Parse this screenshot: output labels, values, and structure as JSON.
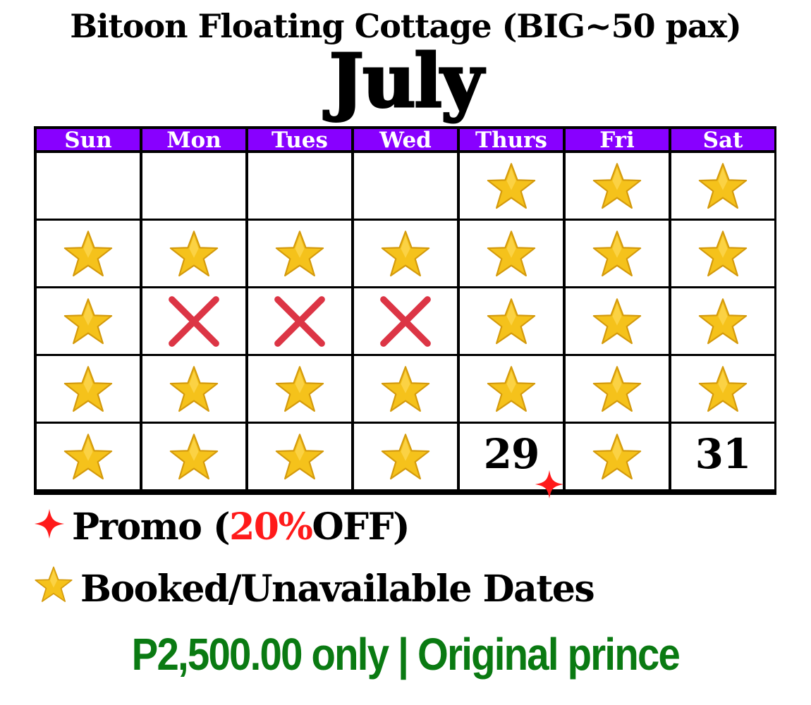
{
  "title": "Bitoon Floating Cottage (BIG~50 pax)",
  "month": "July",
  "colors": {
    "header_bg": "#8800ff",
    "header_text": "#ffffff",
    "star": "#f5c21b",
    "x_mark": "#dc3545",
    "promo": "#ff1a1a",
    "price_text": "#0a7a12"
  },
  "weekdays": [
    "Sun",
    "Mon",
    "Tues",
    "Wed",
    "Thurs",
    "Fri",
    "Sat"
  ],
  "weeks": [
    [
      {
        "mark": "empty"
      },
      {
        "mark": "empty"
      },
      {
        "mark": "empty"
      },
      {
        "mark": "empty"
      },
      {
        "mark": "star"
      },
      {
        "mark": "star"
      },
      {
        "mark": "star"
      }
    ],
    [
      {
        "mark": "star"
      },
      {
        "mark": "star"
      },
      {
        "mark": "star"
      },
      {
        "mark": "star"
      },
      {
        "mark": "star"
      },
      {
        "mark": "star"
      },
      {
        "mark": "star"
      }
    ],
    [
      {
        "mark": "star"
      },
      {
        "mark": "x"
      },
      {
        "mark": "x"
      },
      {
        "mark": "x"
      },
      {
        "mark": "star"
      },
      {
        "mark": "star"
      },
      {
        "mark": "star"
      }
    ],
    [
      {
        "mark": "star"
      },
      {
        "mark": "star"
      },
      {
        "mark": "star"
      },
      {
        "mark": "star"
      },
      {
        "mark": "star"
      },
      {
        "mark": "star"
      },
      {
        "mark": "star"
      }
    ],
    [
      {
        "mark": "star"
      },
      {
        "mark": "star"
      },
      {
        "mark": "star"
      },
      {
        "mark": "star"
      },
      {
        "mark": "number",
        "text": "29",
        "promo": true
      },
      {
        "mark": "star"
      },
      {
        "mark": "number",
        "text": "31"
      }
    ]
  ],
  "icons": {
    "booked": "star-icon",
    "unavailable": "x-mark-icon",
    "promo": "red-sparkle-icon"
  },
  "legend": {
    "promo_prefix": "Promo (",
    "promo_percent": "20%",
    "promo_suffix": " OFF)",
    "booked_label": "Booked/Unavailable Dates"
  },
  "price_text": "P2,500.00 only | Original prince"
}
